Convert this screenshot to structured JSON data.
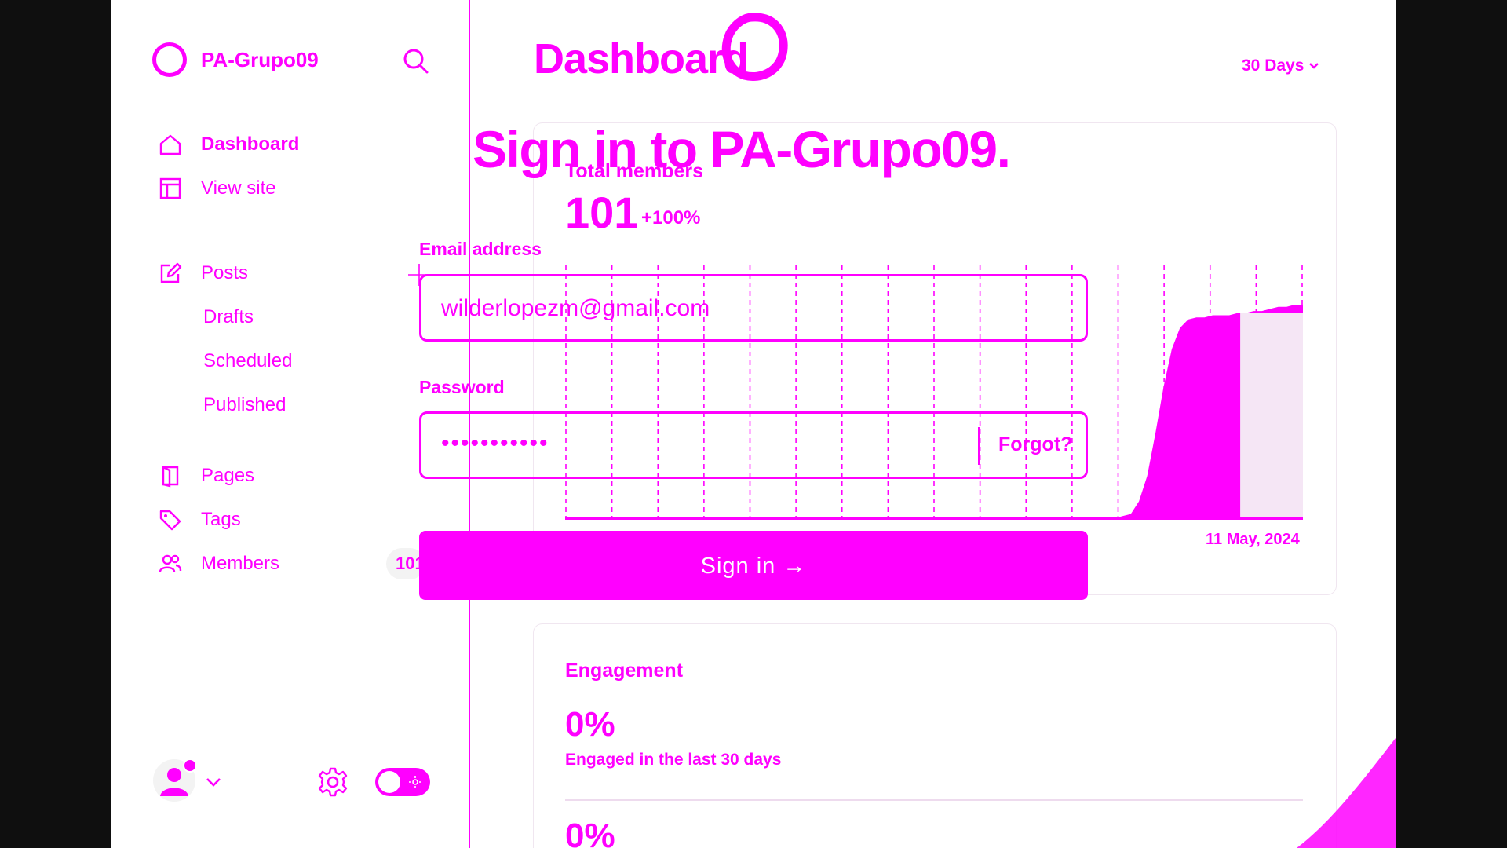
{
  "sidebar": {
    "site_name": "PA-Grupo09",
    "nav": {
      "dashboard": "Dashboard",
      "view_site": "View site",
      "posts": "Posts",
      "drafts": "Drafts",
      "scheduled": "Scheduled",
      "published": "Published",
      "pages": "Pages",
      "tags": "Tags",
      "members": "Members"
    },
    "members_count": "101"
  },
  "dashboard": {
    "title": "Dashboard",
    "range": "30 Days",
    "total_members": {
      "label": "Total members",
      "value": "101",
      "delta": "+100%",
      "date_label": "11 May, 2024"
    },
    "engagement": {
      "title": "Engagement",
      "value": "0%",
      "subtitle": "Engaged in the last 30 days",
      "value2": "0%"
    }
  },
  "signin": {
    "heading": "Sign in to PA-Grupo09.",
    "email_label": "Email address",
    "email_value": "wilderlopezm@gmail.com",
    "password_label": "Password",
    "password_mask": "•••••••••••",
    "forgot_label": "Forgot?",
    "submit_label": "Sign in →"
  },
  "chart_data": {
    "type": "area",
    "series": [
      {
        "values": [
          0,
          0,
          0,
          0,
          0,
          0,
          0,
          0,
          0,
          0,
          0,
          0,
          0,
          0,
          0,
          0,
          0,
          0,
          0,
          0,
          0,
          0,
          0,
          0,
          0,
          0,
          0,
          0,
          0,
          0,
          0,
          0,
          0,
          0,
          0,
          0,
          0,
          0,
          0,
          0,
          0,
          0,
          0,
          0,
          0,
          0,
          0,
          0,
          0,
          0,
          0,
          0,
          0,
          0,
          0,
          0,
          0,
          0,
          0,
          0,
          0,
          0,
          0,
          0,
          0,
          0,
          0,
          0,
          1,
          2,
          8,
          20,
          40,
          62,
          80,
          90,
          94,
          95,
          95,
          96,
          96,
          96,
          97,
          97,
          98,
          98,
          99,
          100,
          100,
          101,
          101
        ]
      }
    ],
    "ylim": [
      0,
      101
    ],
    "grid": "vertical dashed"
  },
  "colors": {
    "accent": "#ff00ff",
    "background": "#ffffff",
    "frame": "#0f0f0f"
  }
}
